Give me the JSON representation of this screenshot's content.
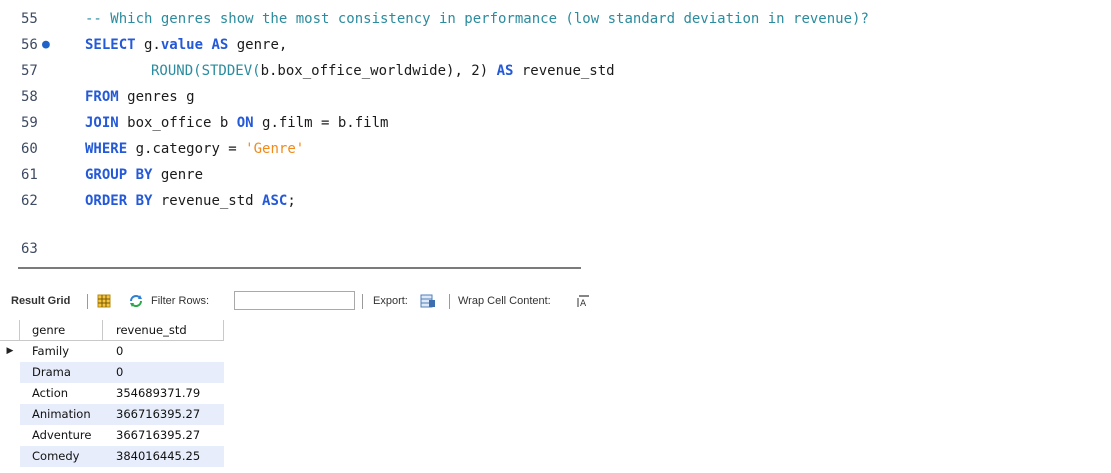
{
  "editor": {
    "lines": [
      {
        "num": "55",
        "dot": false,
        "indent": 0,
        "tokens": [
          {
            "t": "-- Which genres show the most consistency in performance (low standard deviation in revenue)?",
            "c": "cm"
          }
        ]
      },
      {
        "num": "56",
        "dot": true,
        "indent": 0,
        "tokens": [
          {
            "t": "SELECT",
            "c": "kw"
          },
          {
            "t": " g.",
            "c": "plain"
          },
          {
            "t": "value",
            "c": "kw"
          },
          {
            "t": " ",
            "c": "plain"
          },
          {
            "t": "AS",
            "c": "kw"
          },
          {
            "t": " genre,",
            "c": "plain"
          }
        ]
      },
      {
        "num": "57",
        "dot": false,
        "indent": 1,
        "tokens": [
          {
            "t": "ROUND(STDDEV(",
            "c": "cm"
          },
          {
            "t": "b.box_office_worldwide), 2) ",
            "c": "plain"
          },
          {
            "t": "AS",
            "c": "kw"
          },
          {
            "t": " revenue_std",
            "c": "plain"
          }
        ]
      },
      {
        "num": "58",
        "dot": false,
        "indent": 0,
        "tokens": [
          {
            "t": "FROM",
            "c": "kw"
          },
          {
            "t": " genres g",
            "c": "plain"
          }
        ]
      },
      {
        "num": "59",
        "dot": false,
        "indent": 0,
        "tokens": [
          {
            "t": "JOIN",
            "c": "kw"
          },
          {
            "t": " box_office b ",
            "c": "plain"
          },
          {
            "t": "ON",
            "c": "kw"
          },
          {
            "t": " g.film = b.film",
            "c": "plain"
          }
        ]
      },
      {
        "num": "60",
        "dot": false,
        "indent": 0,
        "tokens": [
          {
            "t": "WHERE",
            "c": "kw"
          },
          {
            "t": " g.category = ",
            "c": "plain"
          },
          {
            "t": "'Genre'",
            "c": "str"
          }
        ]
      },
      {
        "num": "61",
        "dot": false,
        "indent": 0,
        "tokens": [
          {
            "t": "GROUP BY",
            "c": "kw"
          },
          {
            "t": " genre",
            "c": "plain"
          }
        ]
      },
      {
        "num": "62",
        "dot": false,
        "indent": 0,
        "tokens": [
          {
            "t": "ORDER BY",
            "c": "kw"
          },
          {
            "t": " revenue_std ",
            "c": "plain"
          },
          {
            "t": "ASC",
            "c": "kw"
          },
          {
            "t": ";",
            "c": "plain"
          }
        ]
      }
    ]
  },
  "toolbar": {
    "result_grid_label": "Result Grid",
    "filter_rows_label": "Filter Rows:",
    "filter_value": "",
    "export_label": "Export:",
    "wrap_label": "Wrap Cell Content:"
  },
  "grid": {
    "columns": [
      "genre",
      "revenue_std"
    ],
    "rows": [
      [
        "Family",
        "0"
      ],
      [
        "Drama",
        "0"
      ],
      [
        "Action",
        "354689371.79"
      ],
      [
        "Animation",
        "366716395.27"
      ],
      [
        "Adventure",
        "366716395.27"
      ],
      [
        "Comedy",
        "384016445.25"
      ]
    ],
    "selected_row": 0,
    "colors": {
      "stripe": "#e7edfb",
      "header": "#ffffff"
    }
  }
}
